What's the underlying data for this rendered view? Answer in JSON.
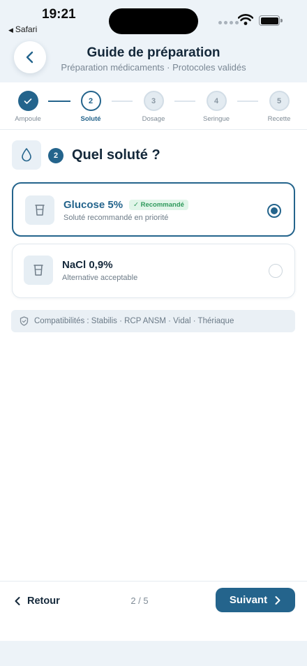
{
  "status_bar": {
    "time": "19:21",
    "back_app": "Safari"
  },
  "header": {
    "title": "Guide de préparation",
    "subtitle": "Préparation médicaments · Protocoles validés"
  },
  "stepper": {
    "steps": [
      {
        "number": "1",
        "label": "Ampoule",
        "state": "done"
      },
      {
        "number": "2",
        "label": "Soluté",
        "state": "active"
      },
      {
        "number": "3",
        "label": "Dosage",
        "state": "todo"
      },
      {
        "number": "4",
        "label": "Seringue",
        "state": "todo"
      },
      {
        "number": "5",
        "label": "Recette",
        "state": "todo"
      }
    ]
  },
  "question": {
    "number": "2",
    "text": "Quel soluté ?",
    "icon": "drop-icon"
  },
  "options": [
    {
      "name": "Glucose 5%",
      "badge": "Recommandé",
      "description": "Soluté recommandé en priorité",
      "selected": true,
      "icon": "cup-icon"
    },
    {
      "name": "NaCl 0,9%",
      "description": "Alternative acceptable",
      "selected": false,
      "icon": "cup-icon"
    }
  ],
  "compatibility": {
    "icon": "shield-icon",
    "text": "Compatibilités : Stabilis · RCP ANSM · Vidal · Thériaque"
  },
  "footer": {
    "back_label": "Retour",
    "page_indicator": "2 / 5",
    "next_label": "Suivant"
  },
  "colors": {
    "primary": "#24648c",
    "success": "#2f9a5c",
    "header_bg": "#edf3f8",
    "text": "#14283a"
  }
}
